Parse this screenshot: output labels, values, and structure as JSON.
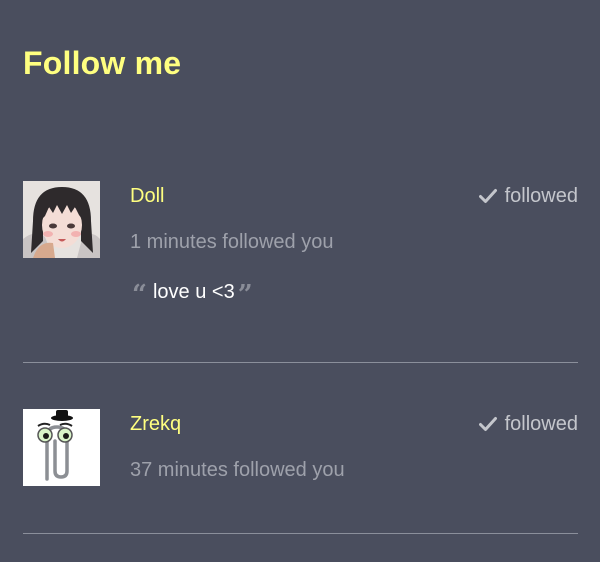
{
  "header": {
    "title": "Follow me"
  },
  "followers": [
    {
      "name": "Doll",
      "time": "1 minutes followed you",
      "status": "followed",
      "message": "love u <3",
      "avatar_icon": "anime-girl-avatar"
    },
    {
      "name": "Zrekq",
      "time": "37 minutes followed you",
      "status": "followed",
      "avatar_icon": "paperclip-character-avatar"
    }
  ],
  "colors": {
    "background": "#4a4e5e",
    "accent": "#ffff80",
    "muted_text": "#9ea1ab",
    "divider": "#8b8f9b"
  }
}
